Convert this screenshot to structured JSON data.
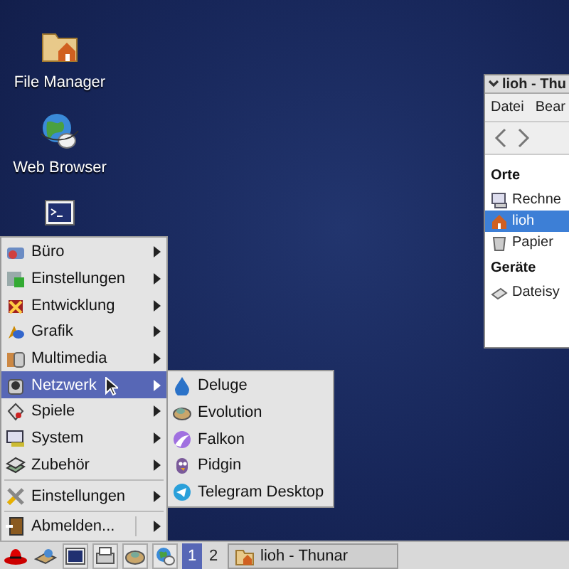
{
  "desktop_icons": [
    {
      "label": "File Manager",
      "kind": "folder"
    },
    {
      "label": "Web Browser",
      "kind": "globe"
    },
    {
      "kind": "terminal"
    }
  ],
  "file_manager": {
    "title": "lioh - Thu",
    "menubar": [
      "Datei",
      "Bear"
    ],
    "sidebar": [
      {
        "heading": "Orte",
        "items": [
          {
            "label": "Rechne",
            "selected": false
          },
          {
            "label": "lioh",
            "selected": true
          },
          {
            "label": "Papier",
            "selected": false
          }
        ]
      },
      {
        "heading": "Geräte",
        "items": [
          {
            "label": "Dateisy",
            "selected": false
          }
        ]
      }
    ]
  },
  "menu": {
    "sections": [
      {
        "items": [
          {
            "label": "Büro",
            "submenu": true,
            "selected": false
          },
          {
            "label": "Einstellungen",
            "submenu": true,
            "selected": false
          },
          {
            "label": "Entwicklung",
            "submenu": true,
            "selected": false
          },
          {
            "label": "Grafik",
            "submenu": true,
            "selected": false
          },
          {
            "label": "Multimedia",
            "submenu": true,
            "selected": false
          },
          {
            "label": "Netzwerk",
            "submenu": true,
            "selected": true
          },
          {
            "label": "Spiele",
            "submenu": true,
            "selected": false
          },
          {
            "label": "System",
            "submenu": true,
            "selected": false
          },
          {
            "label": "Zubehör",
            "submenu": true,
            "selected": false
          }
        ]
      },
      {
        "items": [
          {
            "label": "Einstellungen",
            "submenu": true,
            "selected": false
          }
        ]
      },
      {
        "items": [
          {
            "label": "Abmelden...",
            "submenu": true,
            "selected": false
          }
        ]
      }
    ]
  },
  "submenu": {
    "items": [
      {
        "label": "Deluge"
      },
      {
        "label": "Evolution"
      },
      {
        "label": "Falkon"
      },
      {
        "label": "Pidgin"
      },
      {
        "label": "Telegram Desktop"
      }
    ]
  },
  "taskbar": {
    "pager": [
      {
        "label": "1",
        "selected": true
      },
      {
        "label": "2",
        "selected": false
      }
    ],
    "tasks": [
      {
        "label": "lioh - Thunar"
      }
    ]
  }
}
